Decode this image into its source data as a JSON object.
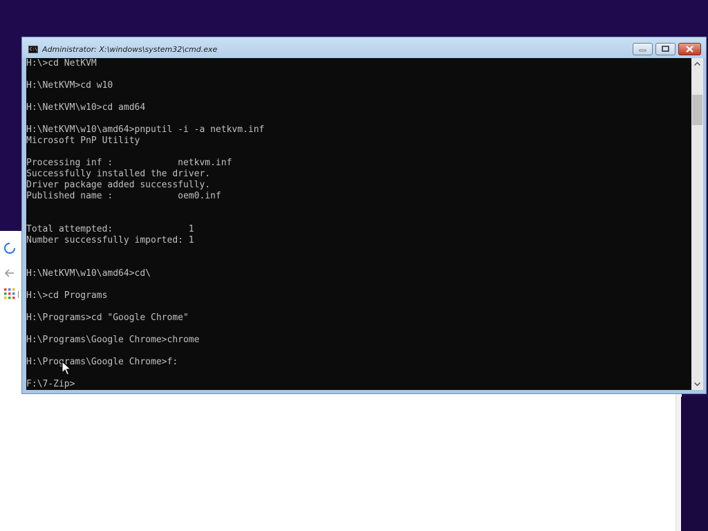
{
  "window": {
    "title": "Administrator: X:\\windows\\system32\\cmd.exe",
    "icon_text": "C:\\"
  },
  "console": {
    "lines": [
      "H:\\>cd NetKVM",
      "",
      "H:\\NetKVM>cd w10",
      "",
      "H:\\NetKVM\\w10>cd amd64",
      "",
      "H:\\NetKVM\\w10\\amd64>pnputil -i -a netkvm.inf",
      "Microsoft PnP Utility",
      "",
      "Processing inf :            netkvm.inf",
      "Successfully installed the driver.",
      "Driver package added successfully.",
      "Published name :            oem0.inf",
      "",
      "",
      "Total attempted:              1",
      "Number successfully imported: 1",
      "",
      "",
      "H:\\NetKVM\\w10\\amd64>cd\\",
      "",
      "H:\\>cd Programs",
      "",
      "H:\\Programs>cd \"Google Chrome\"",
      "",
      "H:\\Programs\\Google Chrome>chrome",
      "",
      "H:\\Programs\\Google Chrome>f:",
      "",
      "F:\\7-Zip>"
    ]
  },
  "icons": {
    "minimize": "minimize-icon",
    "maximize": "maximize-icon",
    "close": "close-icon",
    "scroll_up": "chevron-up-icon",
    "scroll_down": "chevron-down-icon",
    "loading": "loading-spinner-icon",
    "back": "back-arrow-icon",
    "apps": "apps-grid-icon",
    "cursor": "mouse-pointer-icon"
  },
  "colors": {
    "desktop_background": "#1f0a4d",
    "console_background": "#0c0c0c",
    "console_text": "#c0c0c0",
    "close_button": "#c43a21",
    "spinner_blue": "#1a73e8"
  }
}
